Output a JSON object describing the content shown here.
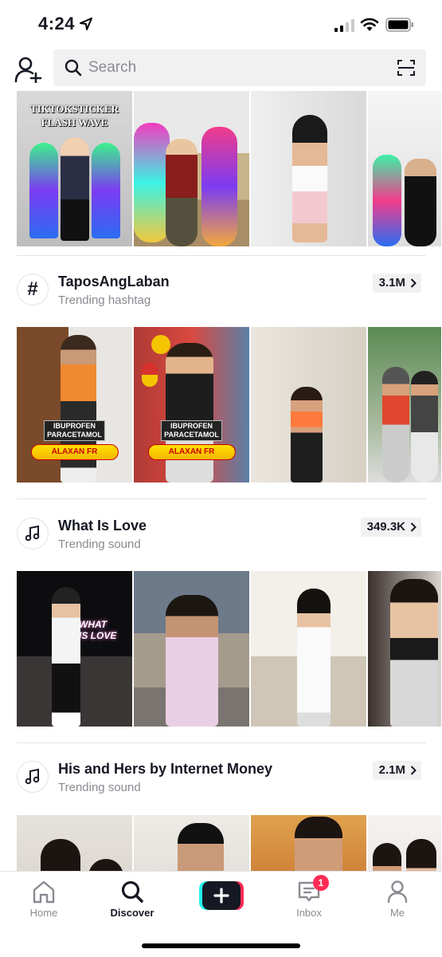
{
  "status_bar": {
    "time": "4:24"
  },
  "search": {
    "placeholder": "Search"
  },
  "top_row": {
    "caption": "TIKTOKSTICKER\nFLASH WAVE"
  },
  "sections": [
    {
      "icon": "hashtag-icon",
      "title": "TaposAngLaban",
      "subtitle": "Trending hashtag",
      "count": "3.1M",
      "promo_text": "IBUPROFEN\nPARACETAMOL",
      "promo_brand": "ALAXAN FR"
    },
    {
      "icon": "music-note-icon",
      "title": "What Is Love",
      "subtitle": "Trending sound",
      "count": "349.3K",
      "overlay": "WHAT\nIS LOVE"
    },
    {
      "icon": "music-note-icon",
      "title": "His and Hers by Internet Money",
      "subtitle": "Trending sound",
      "count": "2.1M"
    }
  ],
  "tabbar": {
    "home": "Home",
    "discover": "Discover",
    "inbox": "Inbox",
    "me": "Me",
    "inbox_badge": "1"
  },
  "colors": {
    "accent": "#fe2c55",
    "teal": "#25f4ee",
    "text": "#161823",
    "muted": "#8a8b91"
  }
}
